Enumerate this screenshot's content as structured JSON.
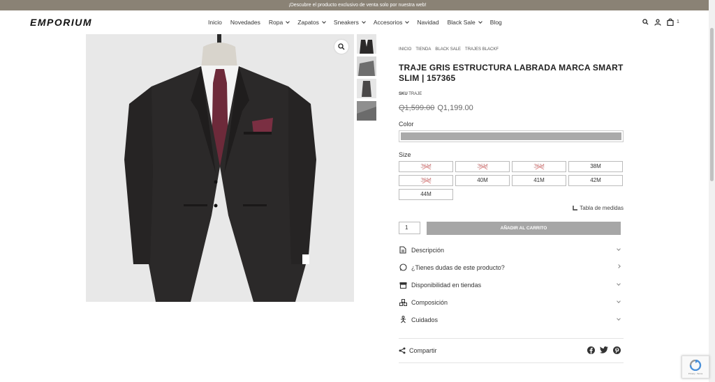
{
  "topbar": {
    "text": "¡Descubre el producto exclusivo de venta solo por nuestra web!"
  },
  "header": {
    "logo": "EMPORIUM",
    "nav": [
      {
        "label": "Inicio",
        "dropdown": false
      },
      {
        "label": "Novedades",
        "dropdown": false
      },
      {
        "label": "Ropa",
        "dropdown": true
      },
      {
        "label": "Zapatos",
        "dropdown": true
      },
      {
        "label": "Sneakers",
        "dropdown": true
      },
      {
        "label": "Accesorios",
        "dropdown": true
      },
      {
        "label": "Navidad",
        "dropdown": false
      },
      {
        "label": "Black Sale",
        "dropdown": true
      },
      {
        "label": "Blog",
        "dropdown": false
      }
    ],
    "cart_count": "1",
    "icons": [
      "search-icon",
      "user-icon",
      "cart-icon"
    ]
  },
  "product": {
    "breadcrumbs": [
      "INICIO",
      "TIENDA",
      "BLACK SALE",
      "TRAJES BLACKF"
    ],
    "title": "TRAJE GRIS ESTRUCTURA LABRADA MARCA SMART SLIM | 157365",
    "sku_label": "SKU",
    "sku_value": "TRAJE",
    "price_old": "Q1,599.00",
    "price_new": "Q1,199.00",
    "color_label": "Color",
    "color_swatch": "#aaaaaa",
    "size_label": "Size",
    "sizes": [
      {
        "label": "36M",
        "available": false
      },
      {
        "label": "36M",
        "available": false
      },
      {
        "label": "36M",
        "available": false
      },
      {
        "label": "38M",
        "available": true
      },
      {
        "label": "38M",
        "available": false
      },
      {
        "label": "40M",
        "available": true
      },
      {
        "label": "41M",
        "available": true
      },
      {
        "label": "42M",
        "available": true
      },
      {
        "label": "44M",
        "available": true
      }
    ],
    "measure_link": "Tabla de medidas",
    "quantity": "1",
    "add_to_cart": "AÑADIR AL CARRITO",
    "accordion": [
      {
        "label": "Descripción",
        "icon": "document-icon",
        "arrow": "down"
      },
      {
        "label": "¿Tienes dudas de este producto?",
        "icon": "whatsapp-icon",
        "arrow": "right"
      },
      {
        "label": "Disponibilidad en tiendas",
        "icon": "store-icon",
        "arrow": "down"
      },
      {
        "label": "Composición",
        "icon": "boxes-icon",
        "arrow": "down"
      },
      {
        "label": "Cuidados",
        "icon": "washing-icon",
        "arrow": "down"
      }
    ],
    "share_label": "Compartir",
    "socials": [
      "facebook-icon",
      "twitter-icon",
      "pinterest-icon"
    ]
  },
  "recaptcha": {
    "text": "Privacy - Terms"
  },
  "colors": {
    "topbar": "#8a8275",
    "button": "#a6a6a6",
    "suit": "#2b2929",
    "tie": "#6d2a3a"
  }
}
